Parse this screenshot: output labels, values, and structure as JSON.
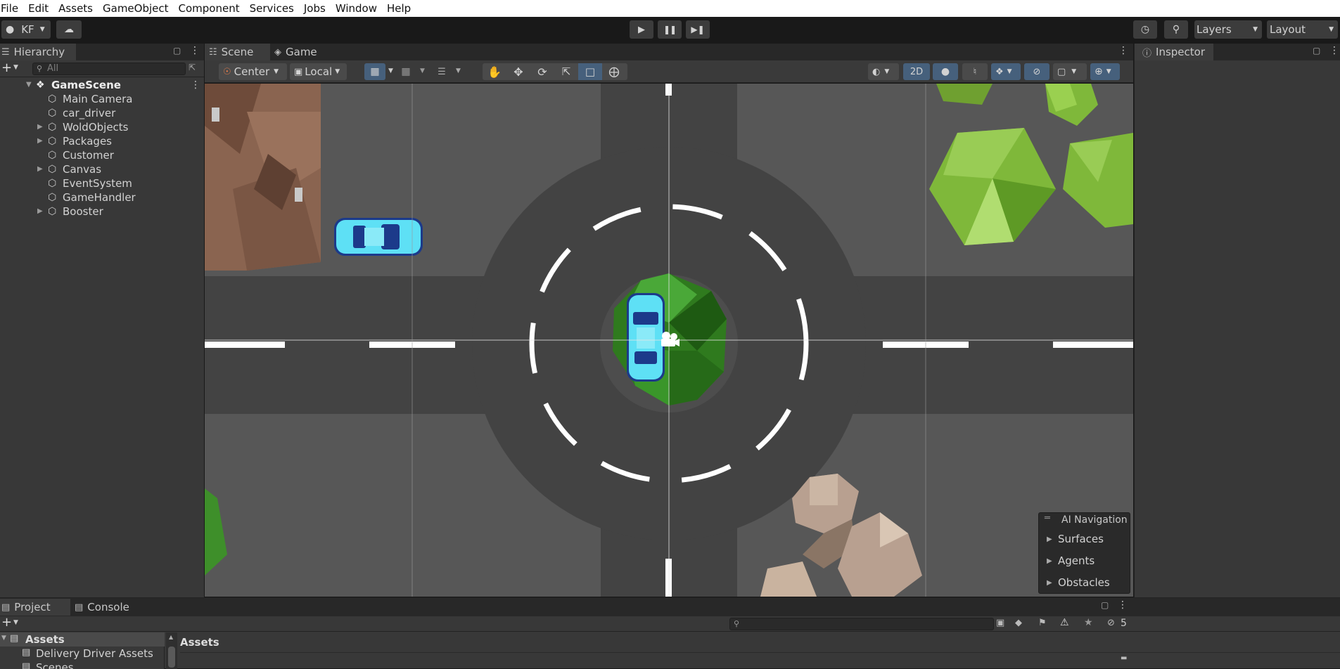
{
  "menu": [
    "File",
    "Edit",
    "Assets",
    "GameObject",
    "Component",
    "Services",
    "Jobs",
    "Window",
    "Help"
  ],
  "toolbar": {
    "account": "KF",
    "layers_label": "Layers",
    "layout_label": "Layout"
  },
  "hierarchy": {
    "tab_label": "Hierarchy",
    "search_placeholder": "All",
    "scene_name": "GameScene",
    "items": [
      {
        "label": "Main Camera",
        "expandable": false
      },
      {
        "label": "car_driver",
        "expandable": false
      },
      {
        "label": "WoldObjects",
        "expandable": true
      },
      {
        "label": "Packages",
        "expandable": true
      },
      {
        "label": "Customer",
        "expandable": false
      },
      {
        "label": "Canvas",
        "expandable": true
      },
      {
        "label": "EventSystem",
        "expandable": false
      },
      {
        "label": "GameHandler",
        "expandable": false
      },
      {
        "label": "Booster",
        "expandable": true
      }
    ]
  },
  "scene": {
    "tabs": [
      "Scene",
      "Game"
    ],
    "pivot_label": "Center",
    "space_label": "Local",
    "mode_2d": "2D"
  },
  "ai_navigation": {
    "title": "AI Navigation",
    "items": [
      "Surfaces",
      "Agents",
      "Obstacles"
    ]
  },
  "inspector": {
    "tab_label": "Inspector"
  },
  "bottom": {
    "tabs": [
      "Project",
      "Console"
    ],
    "tree_root": "Assets",
    "tree_items": [
      "Delivery Driver Assets",
      "Scenes"
    ],
    "breadcrumb": "Assets",
    "hidden_count": "5"
  },
  "colors": {
    "accent_blue": "#46607c",
    "road": "#434343",
    "grass": "#575757",
    "car": "#5ee0f5",
    "tree_green": "#3a9a2a",
    "bush_lime": "#8cc63f"
  }
}
